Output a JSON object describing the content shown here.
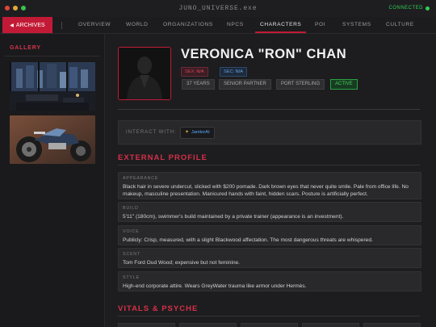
{
  "window": {
    "title": "JUNO_UNIVERSE.exe",
    "status": "CONNECTED",
    "status_color": "#2fcf55"
  },
  "nav": {
    "archives_label": "ARCHIVES",
    "items": [
      {
        "label": "OVERVIEW"
      },
      {
        "label": "WORLD"
      },
      {
        "label": "ORGANIZATIONS"
      },
      {
        "label": "NPCS"
      },
      {
        "label": "CHARACTERS",
        "active": true
      },
      {
        "label": "POI"
      },
      {
        "label": "SYSTEMS"
      },
      {
        "label": "CULTURE"
      }
    ]
  },
  "sidebar": {
    "gallery_title": "GALLERY",
    "images": [
      {
        "name": "night-penthouse-image"
      },
      {
        "name": "motorcycle-image"
      }
    ]
  },
  "profile": {
    "name": "VERONICA \"RON\" CHAN",
    "sex": {
      "key": "SEX:",
      "value": "N/A"
    },
    "sec": {
      "key": "SEC:",
      "value": "N/A"
    },
    "pills": [
      "37 YEARS",
      "SENIOR PARTNER",
      "PORT STERLING",
      "ACTIVE"
    ]
  },
  "interact": {
    "label": "INTERACT WITH:",
    "button": "JanitorAI"
  },
  "external_profile": {
    "title": "EXTERNAL PROFILE",
    "fields": [
      {
        "label": "APPEARANCE",
        "text": "Black hair in severe undercut, slicked with $200 pomade. Dark brown eyes that never quite smile. Pale from office life. No makeup, masculine presentation. Manicured hands with faint, hidden scars. Posture is artificially perfect."
      },
      {
        "label": "BUILD",
        "text": "5'11\" (180cm), swimmer's build maintained by a private trainer (appearance is an investment)."
      },
      {
        "label": "VOICE",
        "text": "Publicly: Crisp, measured, with a slight Blackwood affectation. The most dangerous threats are whispered."
      },
      {
        "label": "SCENT",
        "text": "Tom Ford Oud Wood; expensive but not feminine."
      },
      {
        "label": "STYLE",
        "text": "High-end corporate attire. Wears GreyWater trauma like armor under Hermès."
      }
    ]
  },
  "vitals": {
    "title": "VITALS & PSYCHE"
  },
  "colors": {
    "accent": "#c21a36",
    "active_green": "#46d065",
    "sex_tag": "#e0475c",
    "sec_tag": "#6fa6e8"
  }
}
